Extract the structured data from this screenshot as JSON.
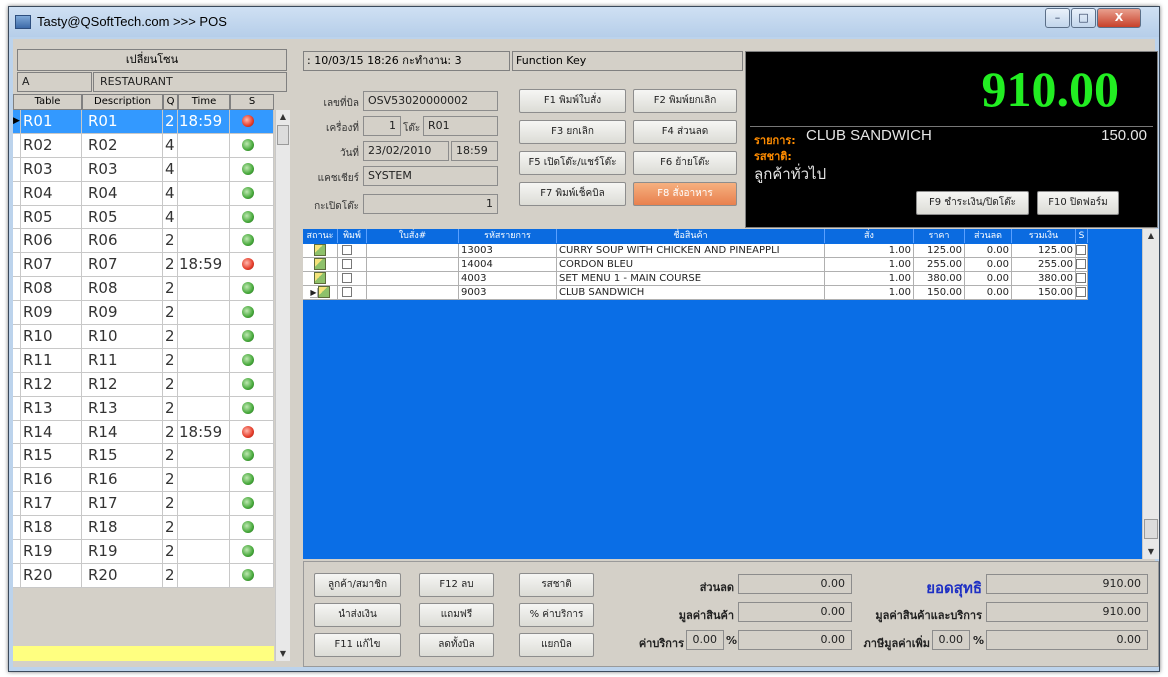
{
  "window": {
    "title": "Tasty@QSoftTech.com >>> POS",
    "min": "–",
    "max": "□",
    "close": "X"
  },
  "left": {
    "zone_button": "เปลี่ยนโซน",
    "zone_code": "A",
    "zone_name": "RESTAURANT",
    "headers": [
      "Table",
      "Description",
      "Q",
      "Time",
      "S"
    ],
    "rows": [
      {
        "table": "R01",
        "desc": "R01",
        "q": "2",
        "time": "18:59",
        "status": "red",
        "selected": true
      },
      {
        "table": "R02",
        "desc": "R02",
        "q": "4",
        "time": "",
        "status": "green"
      },
      {
        "table": "R03",
        "desc": "R03",
        "q": "4",
        "time": "",
        "status": "green"
      },
      {
        "table": "R04",
        "desc": "R04",
        "q": "4",
        "time": "",
        "status": "green"
      },
      {
        "table": "R05",
        "desc": "R05",
        "q": "4",
        "time": "",
        "status": "green"
      },
      {
        "table": "R06",
        "desc": "R06",
        "q": "2",
        "time": "",
        "status": "green"
      },
      {
        "table": "R07",
        "desc": "R07",
        "q": "2",
        "time": "18:59",
        "status": "red"
      },
      {
        "table": "R08",
        "desc": "R08",
        "q": "2",
        "time": "",
        "status": "green"
      },
      {
        "table": "R09",
        "desc": "R09",
        "q": "2",
        "time": "",
        "status": "green"
      },
      {
        "table": "R10",
        "desc": "R10",
        "q": "2",
        "time": "",
        "status": "green"
      },
      {
        "table": "R11",
        "desc": "R11",
        "q": "2",
        "time": "",
        "status": "green"
      },
      {
        "table": "R12",
        "desc": "R12",
        "q": "2",
        "time": "",
        "status": "green"
      },
      {
        "table": "R13",
        "desc": "R13",
        "q": "2",
        "time": "",
        "status": "green"
      },
      {
        "table": "R14",
        "desc": "R14",
        "q": "2",
        "time": "18:59",
        "status": "red"
      },
      {
        "table": "R15",
        "desc": "R15",
        "q": "2",
        "time": "",
        "status": "green"
      },
      {
        "table": "R16",
        "desc": "R16",
        "q": "2",
        "time": "",
        "status": "green"
      },
      {
        "table": "R17",
        "desc": "R17",
        "q": "2",
        "time": "",
        "status": "green"
      },
      {
        "table": "R18",
        "desc": "R18",
        "q": "2",
        "time": "",
        "status": "green"
      },
      {
        "table": "R19",
        "desc": "R19",
        "q": "2",
        "time": "",
        "status": "green"
      },
      {
        "table": "R20",
        "desc": "R20",
        "q": "2",
        "time": "",
        "status": "green"
      }
    ]
  },
  "info": {
    "status_line": ": 10/03/15 18:26 กะทำงาน: 3",
    "bill_no_label": "เลขที่บิล",
    "bill_no": "OSV53020000002",
    "machine_label": "เครื่องที่",
    "machine_no": "1",
    "table_label": "โต๊ะ",
    "table_no": "R01",
    "date_label": "วันที่",
    "date": "23/02/2010",
    "time": "18:59",
    "cashier_label": "แคชเชียร์",
    "cashier": "SYSTEM",
    "open_table_label": "กะเปิดโต๊ะ",
    "open_table_value": "1"
  },
  "function_keys": {
    "header": "Function Key",
    "f1": "F1 พิมพ์ใบสั่ง",
    "f2": "F2 พิมพ์ยกเลิก",
    "f3": "F3 ยกเลิก",
    "f4": "F4 ส่วนลด",
    "f5": "F5 เปิดโต๊ะ/แชร์โต๊ะ",
    "f6": "F6 ย้ายโต๊ะ",
    "f7": "F7 พิมพ์เช็คบิล",
    "f8": "F8 สั่งอาหาร"
  },
  "display": {
    "total": "910.00",
    "item_label": "รายการ:",
    "item_name": "CLUB SANDWICH",
    "item_price": "150.00",
    "flavor_label": "รสชาติ:",
    "customer": "ลูกค้าทั่วไป",
    "f9": "F9 ชำระเงิน/ปิดโต๊ะ",
    "f10": "F10 ปิดฟอร์ม"
  },
  "orders": {
    "headers": [
      "สถานะ",
      "พิมพ์",
      "ใบสั่ง#",
      "รหัสรายการ",
      "ชื่อสินค้า",
      "สั่ง",
      "ราคา",
      "ส่วนลด",
      "รวมเงิน",
      "S"
    ],
    "rows": [
      {
        "code": "13003",
        "name": "CURRY SOUP WITH CHICKEN AND PINEAPPLI",
        "qty": "1.00",
        "price": "125.00",
        "disc": "0.00",
        "total": "125.00"
      },
      {
        "code": "14004",
        "name": "CORDON BLEU",
        "qty": "1.00",
        "price": "255.00",
        "disc": "0.00",
        "total": "255.00"
      },
      {
        "code": "4003",
        "name": "SET MENU 1 - MAIN COURSE",
        "qty": "1.00",
        "price": "380.00",
        "disc": "0.00",
        "total": "380.00"
      },
      {
        "code": "9003",
        "name": "CLUB SANDWICH",
        "qty": "1.00",
        "price": "150.00",
        "disc": "0.00",
        "total": "150.00"
      }
    ]
  },
  "bottom": {
    "member_btn": "ลูกค้า/สมาชิก",
    "f12_btn": "F12 ลบ",
    "flavor_btn": "รสชาติ",
    "deposit_btn": "นำส่งเงิน",
    "free_btn": "แถมฟรี",
    "service_pct_btn": "% ค่าบริการ",
    "f11_btn": "F11 แก้ไข",
    "bill_disc_btn": "ลดทั้งบิล",
    "split_btn": "แยกบิล",
    "discount_label": "ส่วนลด",
    "discount_value": "0.00",
    "goods_label": "มูลค่าสินค้า",
    "goods_value": "0.00",
    "service_label": "ค่าบริการ",
    "service_pct": "0.00",
    "pct_sign": "%",
    "service_value": "0.00",
    "net_label": "ยอดสุทธิ",
    "net_value": "910.00",
    "goods_service_label": "มูลค่าสินค้าและบริการ",
    "goods_service_value": "910.00",
    "vat_label": "ภาษีมูลค่าเพิ่ม",
    "vat_pct": "0.00",
    "vat_value": "0.00"
  }
}
